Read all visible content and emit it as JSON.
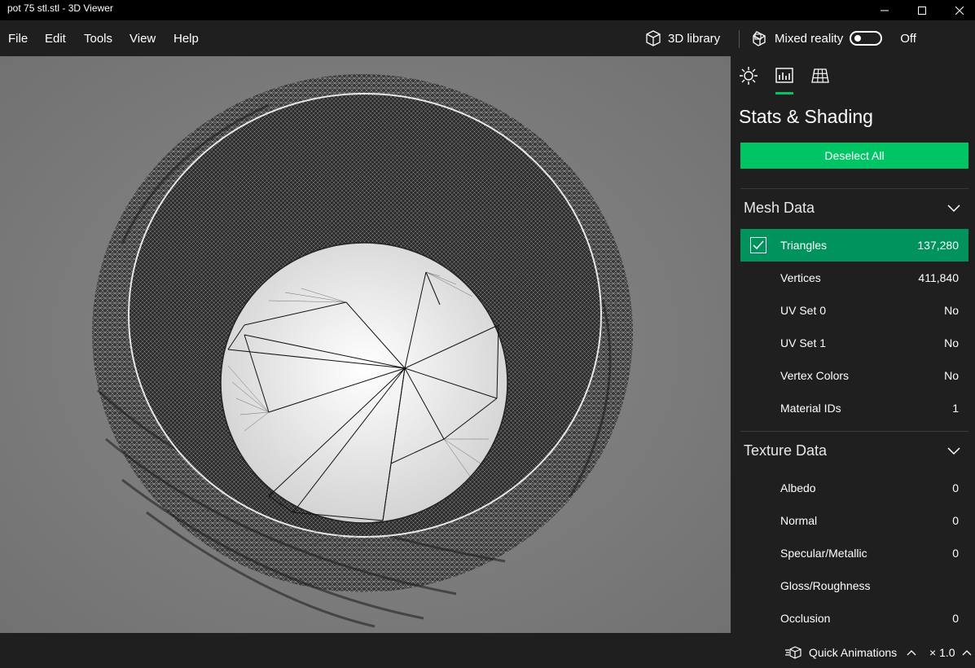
{
  "window": {
    "title": "pot 75 stl.stl - 3D Viewer",
    "controls": [
      "minimize-icon",
      "maximize-icon",
      "close-icon"
    ]
  },
  "menu": {
    "items": [
      {
        "label": "File"
      },
      {
        "label": "Edit"
      },
      {
        "label": "Tools"
      },
      {
        "label": "View"
      },
      {
        "label": "Help"
      }
    ]
  },
  "toolbar": {
    "library_label": "3D library",
    "library_icon": "cube-icon",
    "mixed_reality_label": "Mixed reality",
    "mixed_reality_icon": "mixed-reality-icon",
    "toggle_state": "Off"
  },
  "panel": {
    "tabs": [
      {
        "icon": "lighting-icon",
        "active": false
      },
      {
        "icon": "stats-icon",
        "active": true
      },
      {
        "icon": "grid-icon",
        "active": false
      }
    ],
    "title": "Stats & Shading",
    "deselect_label": "Deselect All",
    "mesh_section": {
      "title": "Mesh Data",
      "rows": [
        {
          "label": "Triangles",
          "value": "137,280",
          "selected": true
        },
        {
          "label": "Vertices",
          "value": "411,840"
        },
        {
          "label": "UV Set 0",
          "value": "No"
        },
        {
          "label": "UV Set 1",
          "value": "No"
        },
        {
          "label": "Vertex Colors",
          "value": "No"
        },
        {
          "label": "Material IDs",
          "value": "1"
        }
      ]
    },
    "texture_section": {
      "title": "Texture Data",
      "rows": [
        {
          "label": "Albedo",
          "value": "0"
        },
        {
          "label": "Normal",
          "value": "0"
        },
        {
          "label": "Specular/Metallic",
          "value": "0"
        },
        {
          "label": "Gloss/Roughness",
          "value": ""
        },
        {
          "label": "Occlusion",
          "value": "0"
        }
      ]
    }
  },
  "status": {
    "animations_label": "Quick Animations",
    "animations_icon": "animation-icon",
    "speed": "× 1.0"
  },
  "colors": {
    "accent": "#00c565",
    "selected_row": "#00935b",
    "background": "#1f1f1f",
    "viewport": "#7b7b7b"
  }
}
